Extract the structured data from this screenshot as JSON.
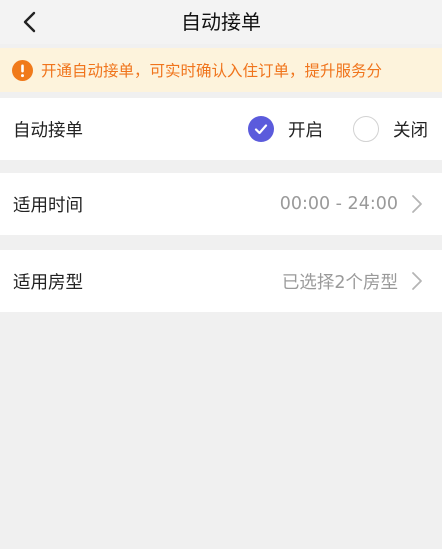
{
  "header": {
    "title": "自动接单",
    "back_icon": "chevron-left-icon"
  },
  "notice": {
    "icon": "info-icon",
    "icon_color": "#f07a1b",
    "text": "开通自动接单，可实时确认入住订单，提升服务分",
    "text_color": "#f0741c",
    "background": "#fdf3dc"
  },
  "auto_accept": {
    "label": "自动接单",
    "options": [
      {
        "label": "开启",
        "selected": true
      },
      {
        "label": "关闭",
        "selected": false
      }
    ],
    "accent_color": "#5b5bdc"
  },
  "time_setting": {
    "label": "适用时间",
    "value": "00:00 - 24:00"
  },
  "room_setting": {
    "label": "适用房型",
    "value": "已选择2个房型"
  }
}
